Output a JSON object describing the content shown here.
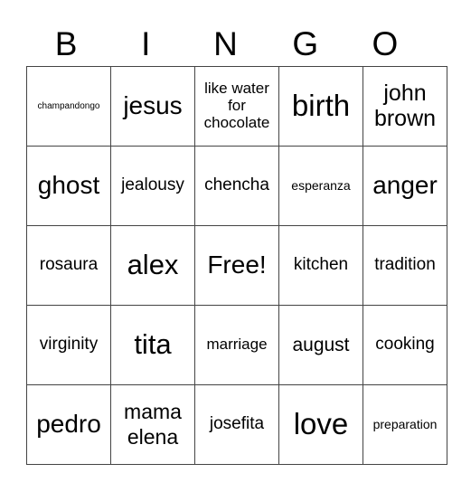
{
  "header": {
    "letters": [
      "B",
      "I",
      "N",
      "G",
      "O"
    ]
  },
  "board": {
    "rows": [
      [
        "champandongo",
        "jesus",
        "like water for chocolate",
        "birth",
        "john brown"
      ],
      [
        "ghost",
        "jealousy",
        "chencha",
        "esperanza",
        "anger"
      ],
      [
        "rosaura",
        "alex",
        "Free!",
        "kitchen",
        "tradition"
      ],
      [
        "virginity",
        "tita",
        "marriage",
        "august",
        "cooking"
      ],
      [
        "pedro",
        "mama elena",
        "josefita",
        "love",
        "preparation"
      ]
    ]
  }
}
